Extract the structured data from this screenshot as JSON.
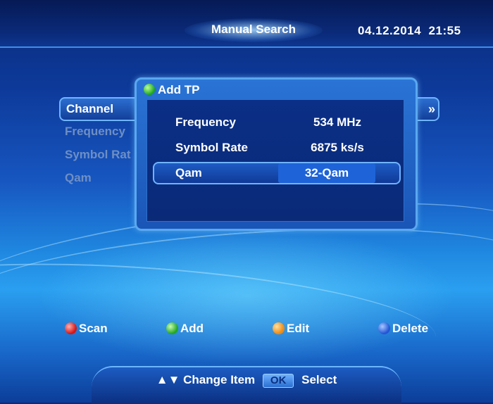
{
  "header": {
    "title": "Manual Search",
    "date": "04.12.2014",
    "time": "21:55"
  },
  "menu": {
    "items": [
      {
        "label": "Channel",
        "state": "selected"
      },
      {
        "label": "Frequency",
        "state": "dim"
      },
      {
        "label": "Symbol Rat",
        "state": "dim"
      },
      {
        "label": "Qam",
        "state": "dim"
      }
    ],
    "arrow": "»"
  },
  "dialog": {
    "title": "Add TP",
    "title_icon": "green-dot-icon",
    "rows": [
      {
        "label": "Frequency",
        "value": "534 MHz"
      },
      {
        "label": "Symbol Rate",
        "value": "6875 ks/s"
      },
      {
        "label": "Qam",
        "value": "32-Qam",
        "selected": true
      }
    ]
  },
  "legend": [
    {
      "label": "Scan",
      "color": "#d61515"
    },
    {
      "label": "Add",
      "color": "#22a622"
    },
    {
      "label": "Edit",
      "color": "#f08a10"
    },
    {
      "label": "Delete",
      "color": "#2255d6"
    }
  ],
  "footer": {
    "arrows": "▲▼",
    "change_item": "Change Item",
    "ok": "OK",
    "select": "Select"
  }
}
